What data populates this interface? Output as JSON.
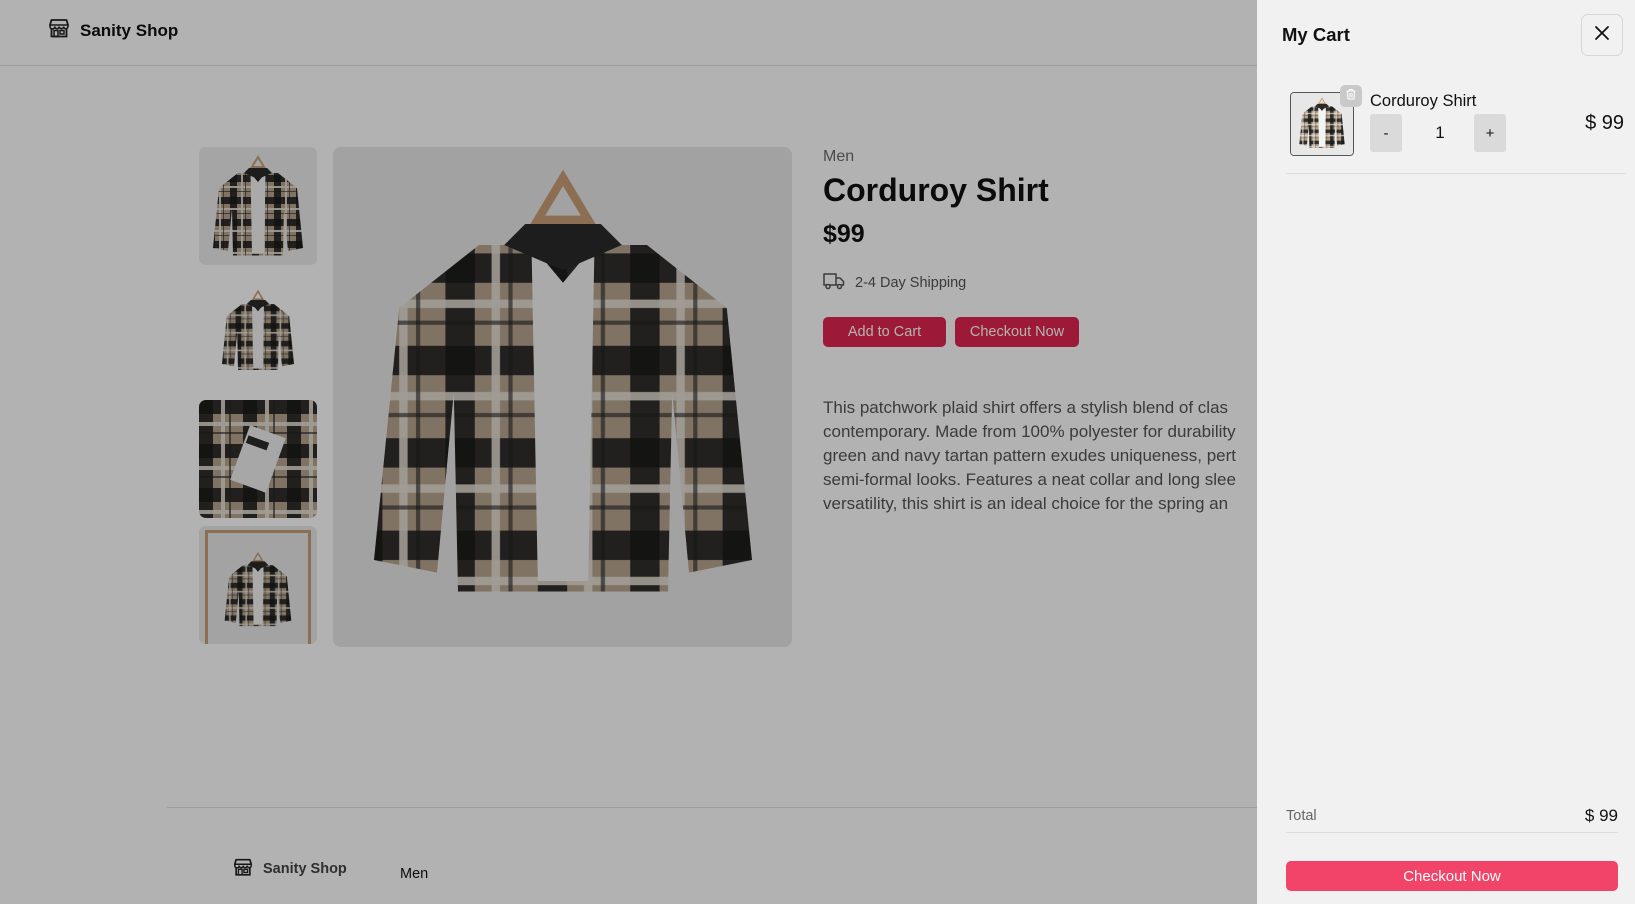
{
  "header": {
    "brand": "Sanity Shop"
  },
  "product": {
    "category": "Men",
    "title": "Corduroy Shirt",
    "price": "$99",
    "shipping": "2-4 Day Shipping",
    "add_to_cart_label": "Add to Cart",
    "checkout_label": "Checkout Now",
    "description": [
      "This patchwork plaid shirt offers a stylish blend of clas",
      "contemporary. Made from 100% polyester for durability",
      "green and navy tartan pattern exudes uniqueness, pert",
      "semi-formal looks. Features a neat collar and long slee",
      "versatility, this shirt is an ideal choice for the spring an"
    ]
  },
  "footer": {
    "brand": "Sanity Shop",
    "link": "Men"
  },
  "cart": {
    "title": "My Cart",
    "item": {
      "name": "Corduroy Shirt",
      "quantity": "1",
      "price": "$ 99",
      "minus": "-",
      "plus": "+"
    },
    "total_label": "Total",
    "total_value": "$ 99",
    "checkout_label": "Checkout Now"
  },
  "icons": {
    "brand": "storefront-icon",
    "shipping": "truck-icon",
    "close": "close-icon",
    "trash": "trash-icon"
  },
  "colors": {
    "accent_red": "#e0254f",
    "checkout_pink": "#f14468",
    "drawer_bg": "#f1f1f1"
  }
}
